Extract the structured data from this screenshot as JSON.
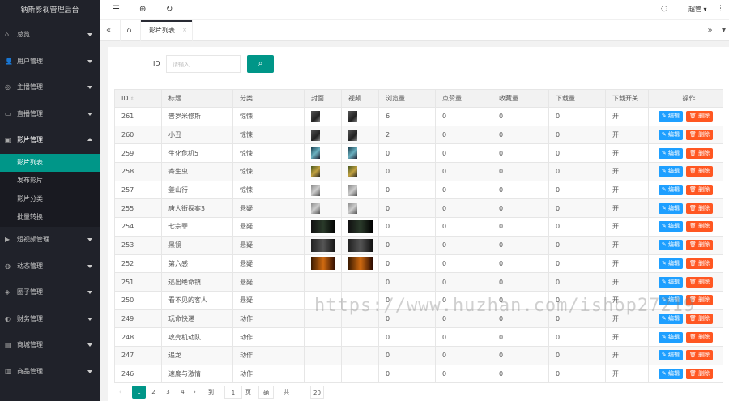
{
  "app": {
    "title": "钠斯影视管理后台"
  },
  "topbar": {
    "user": "超管"
  },
  "sidebar": {
    "items": [
      {
        "label": "总览",
        "icon": "home-icon"
      },
      {
        "label": "用户管理",
        "icon": "user-icon"
      },
      {
        "label": "主播管理",
        "icon": "anchor-icon"
      },
      {
        "label": "直播管理",
        "icon": "live-icon"
      },
      {
        "label": "影片管理",
        "icon": "film-icon"
      },
      {
        "label": "短视频管理",
        "icon": "video-icon"
      },
      {
        "label": "动态管理",
        "icon": "feed-icon"
      },
      {
        "label": "圈子管理",
        "icon": "circle-icon"
      },
      {
        "label": "财务管理",
        "icon": "finance-icon"
      },
      {
        "label": "商城管理",
        "icon": "shop-icon"
      },
      {
        "label": "商品管理",
        "icon": "goods-icon"
      }
    ],
    "sub_items": [
      "影片列表",
      "发布影片",
      "影片分类",
      "批量转换"
    ]
  },
  "tabs": {
    "active": "影片列表",
    "close": "×"
  },
  "search": {
    "label": "ID",
    "placeholder": "请输入",
    "button_icon": "search-icon"
  },
  "table": {
    "headers": [
      "ID",
      "标题",
      "分类",
      "封面",
      "视频",
      "浏览量",
      "点赞量",
      "收藏量",
      "下载量",
      "下载开关",
      "操作"
    ],
    "rows": [
      [
        "261",
        "普罗米修斯",
        "惊悚",
        "6",
        "0",
        "0",
        "0",
        "开"
      ],
      [
        "260",
        "小丑",
        "惊悚",
        "2",
        "0",
        "0",
        "0",
        "开"
      ],
      [
        "259",
        "生化危机5",
        "惊悚",
        "0",
        "0",
        "0",
        "0",
        "开"
      ],
      [
        "258",
        "寄生虫",
        "惊悚",
        "0",
        "0",
        "0",
        "0",
        "开"
      ],
      [
        "257",
        "釜山行",
        "惊悚",
        "0",
        "0",
        "0",
        "0",
        "开"
      ],
      [
        "255",
        "唐人街探案3",
        "悬疑",
        "0",
        "0",
        "0",
        "0",
        "开"
      ],
      [
        "254",
        "七宗罪",
        "悬疑",
        "0",
        "0",
        "0",
        "0",
        "开"
      ],
      [
        "253",
        "黑镜",
        "悬疑",
        "0",
        "0",
        "0",
        "0",
        "开"
      ],
      [
        "252",
        "第六感",
        "悬疑",
        "0",
        "0",
        "0",
        "0",
        "开"
      ],
      [
        "251",
        "逃出绝命镇",
        "悬疑",
        "0",
        "0",
        "0",
        "0",
        "开"
      ],
      [
        "250",
        "看不见的客人",
        "悬疑",
        "0",
        "0",
        "0",
        "0",
        "开"
      ],
      [
        "249",
        "玩命快递",
        "动作",
        "0",
        "0",
        "0",
        "0",
        "开"
      ],
      [
        "248",
        "攻壳机动队",
        "动作",
        "0",
        "0",
        "0",
        "0",
        "开"
      ],
      [
        "247",
        "追龙",
        "动作",
        "0",
        "0",
        "0",
        "0",
        "开"
      ],
      [
        "246",
        "速度与激情",
        "动作",
        "0",
        "0",
        "0",
        "0",
        "开"
      ]
    ],
    "edit_label": "✎ 编辑",
    "delete_label": "🗑 删除"
  },
  "pager": {
    "pages": [
      "1",
      "2",
      "3",
      "4"
    ],
    "goto": "到第",
    "page_value": "1",
    "page_unit": "页",
    "confirm": "确定",
    "total": "共 78 条",
    "size": "20 条/页 ▾"
  },
  "watermark": "https://www.huzhan.com/ishop27219"
}
